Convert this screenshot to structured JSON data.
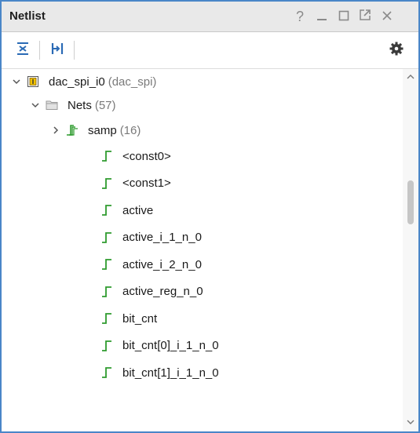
{
  "window": {
    "title": "Netlist",
    "help_glyph": "?",
    "minimize_glyph": "_",
    "maximize_glyph": "□",
    "float_glyph": "↗",
    "close_glyph": "✕"
  },
  "toolbar": {
    "buttons": [
      {
        "name": "collapse-all",
        "icon": "collapse-all-icon"
      },
      {
        "name": "expand-hierarchy",
        "icon": "hierarchy-icon"
      }
    ],
    "settings_icon": "gear-icon"
  },
  "tree": {
    "root": {
      "label": "dac_spi_i0",
      "detail": "(dac_spi)",
      "icon": "cell-icon",
      "expanded": true
    },
    "nets_folder": {
      "label": "Nets",
      "count": "(57)",
      "icon": "folder-icon",
      "expanded": true
    },
    "bus": {
      "label": "samp",
      "count": "(16)",
      "icon": "bus-net-icon",
      "expanded": false
    },
    "nets": [
      "<const0>",
      "<const1>",
      "active",
      "active_i_1_n_0",
      "active_i_2_n_0",
      "active_reg_n_0",
      "bit_cnt",
      "bit_cnt[0]_i_1_n_0",
      "bit_cnt[1]_i_1_n_0"
    ]
  },
  "colors": {
    "accent_border": "#4a86c8",
    "net_icon_green": "#2e9b2e",
    "title_bar": "#e9e9e9"
  }
}
